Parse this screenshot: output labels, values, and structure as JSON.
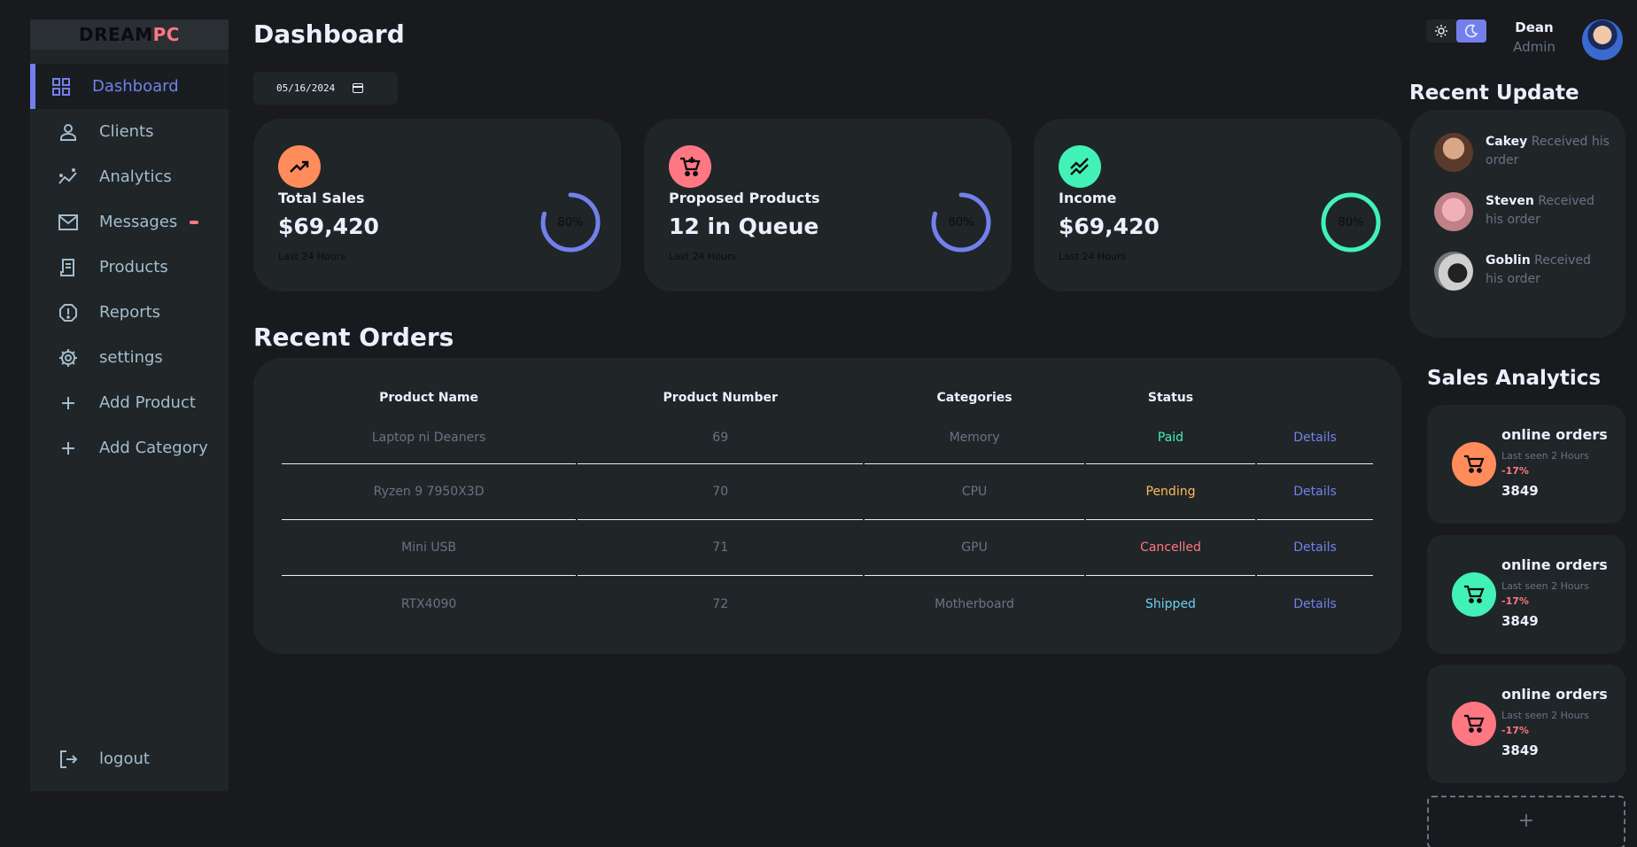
{
  "logo": {
    "part1": "DREAM",
    "part2": "PC"
  },
  "sidebar": {
    "items": [
      {
        "label": "Dashboard",
        "icon": "grid-icon"
      },
      {
        "label": "Clients",
        "icon": "person-icon"
      },
      {
        "label": "Analytics",
        "icon": "insights-icon"
      },
      {
        "label": "Messages",
        "icon": "mail-icon"
      },
      {
        "label": "Products",
        "icon": "receipt-icon"
      },
      {
        "label": "Reports",
        "icon": "report-icon"
      },
      {
        "label": "settings",
        "icon": "gear-icon"
      },
      {
        "label": "Add Product",
        "icon": "plus-icon"
      },
      {
        "label": "Add Category",
        "icon": "plus-icon"
      }
    ],
    "logout": "logout"
  },
  "main": {
    "title": "Dashboard",
    "date": "05/16/2024",
    "cards": [
      {
        "label": "Total Sales",
        "value": "$69,420",
        "sub": "Last 24 Hours",
        "percent": "80%",
        "progress": 0.8,
        "icon_color": "#ff8c5a",
        "ring_color": "#7380ec"
      },
      {
        "label": "Proposed Products",
        "value": "12 in Queue",
        "sub": "Last 24 Hours",
        "percent": "80%",
        "progress": 0.8,
        "icon_color": "#ff7782",
        "ring_color": "#7380ec"
      },
      {
        "label": "Income",
        "value": "$69,420",
        "sub": "Last 24 Hours",
        "percent": "80%",
        "progress": 1.0,
        "icon_color": "#41f1b6",
        "ring_color": "#41f1b6"
      }
    ],
    "orders_title": "Recent Orders",
    "orders": {
      "headers": [
        "Product Name",
        "Product Number",
        "Categories",
        "Status",
        ""
      ],
      "rows": [
        {
          "name": "Laptop ni Deaners",
          "number": "69",
          "category": "Memory",
          "status": "Paid",
          "action": "Details"
        },
        {
          "name": "Ryzen 9 7950X3D",
          "number": "70",
          "category": "CPU",
          "status": "Pending",
          "action": "Details"
        },
        {
          "name": "Mini USB",
          "number": "71",
          "category": "GPU",
          "status": "Cancelled",
          "action": "Details"
        },
        {
          "name": "RTX4090",
          "number": "72",
          "category": "Motherboard",
          "status": "Shipped",
          "action": "Details"
        }
      ]
    }
  },
  "profile": {
    "name": "Dean",
    "role": "Admin"
  },
  "recent_update": {
    "title": "Recent Update",
    "items": [
      {
        "name": "Cakey",
        "text": "Received his order"
      },
      {
        "name": "Steven",
        "text": "Received his order"
      },
      {
        "name": "Goblin",
        "text": "Received his order"
      }
    ]
  },
  "sales_analytics": {
    "title": "Sales Analytics",
    "items": [
      {
        "title": "online orders",
        "sub": "Last seen 2 Hours",
        "change": "-17%",
        "value": "3849",
        "color": "#ff8c5a"
      },
      {
        "title": "online orders",
        "sub": "Last seen 2 Hours",
        "change": "-17%",
        "value": "3849",
        "color": "#41f1b6"
      },
      {
        "title": "online orders",
        "sub": "Last seen 2 Hours",
        "change": "-17%",
        "value": "3849",
        "color": "#ff7782"
      }
    ],
    "add": "+"
  }
}
